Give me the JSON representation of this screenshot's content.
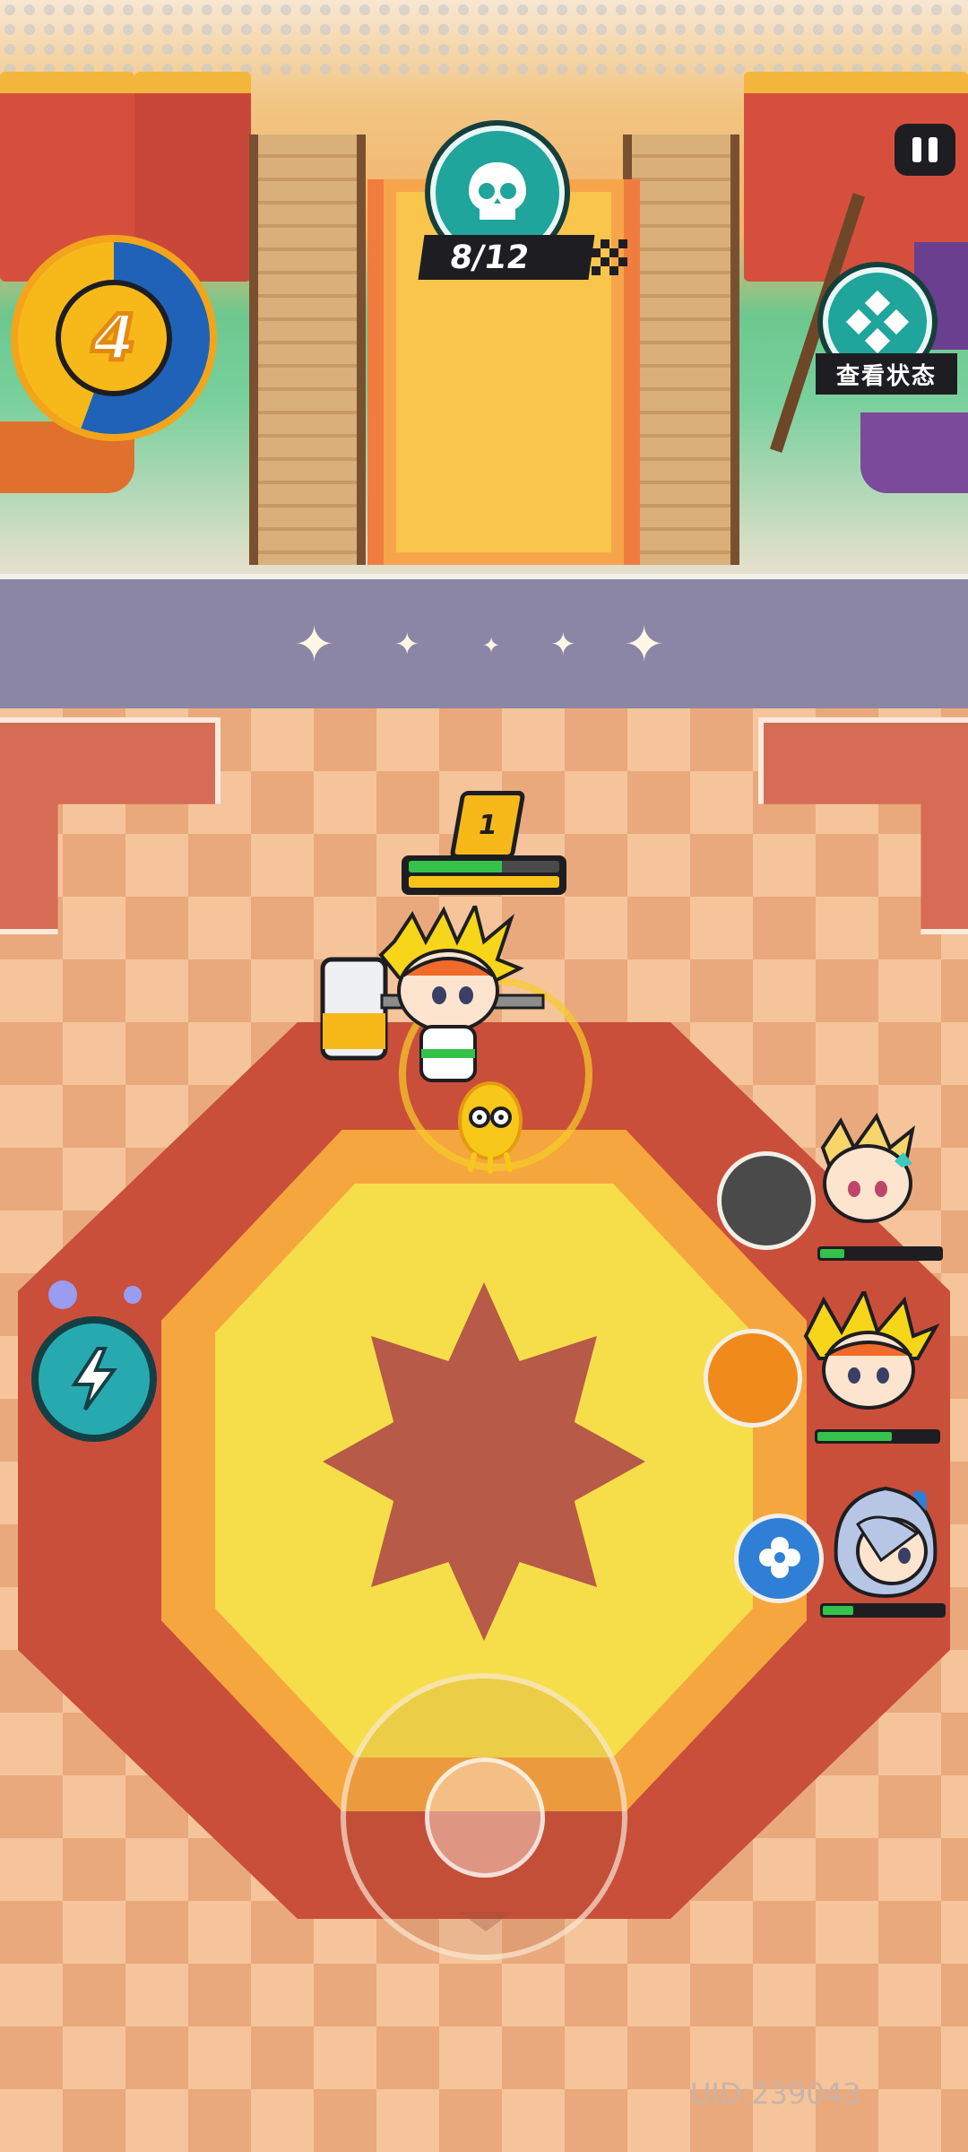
{
  "hud": {
    "kill_counter": "8/12",
    "energy_level": "4",
    "status_button_label": "查看状态",
    "pause_icon": "pause-icon",
    "skull_icon": "skull-icon",
    "status_icon": "diamond-grid-icon"
  },
  "player": {
    "level": "1",
    "hp_fraction": 0.62,
    "energy_fraction": 1.0
  },
  "team": [
    {
      "name": "blonde-star-hero",
      "hp_fraction": 0.2,
      "skill_color": "#4a4a4a"
    },
    {
      "name": "yellow-spiky-hero",
      "hp_fraction": 0.62,
      "skill_color": "#f08a1a"
    },
    {
      "name": "blue-hair-hero",
      "hp_fraction": 0.25,
      "skill_color": "#2f7fd6"
    }
  ],
  "skills": {
    "left_skill_icon": "lightning-icon"
  },
  "footer": {
    "uid": "UID:239043"
  },
  "colors": {
    "hud_dark": "#1e1e22",
    "accent_teal": "#1fa59b",
    "hp_green": "#35c24b",
    "energy_yellow": "#f7c21a"
  }
}
